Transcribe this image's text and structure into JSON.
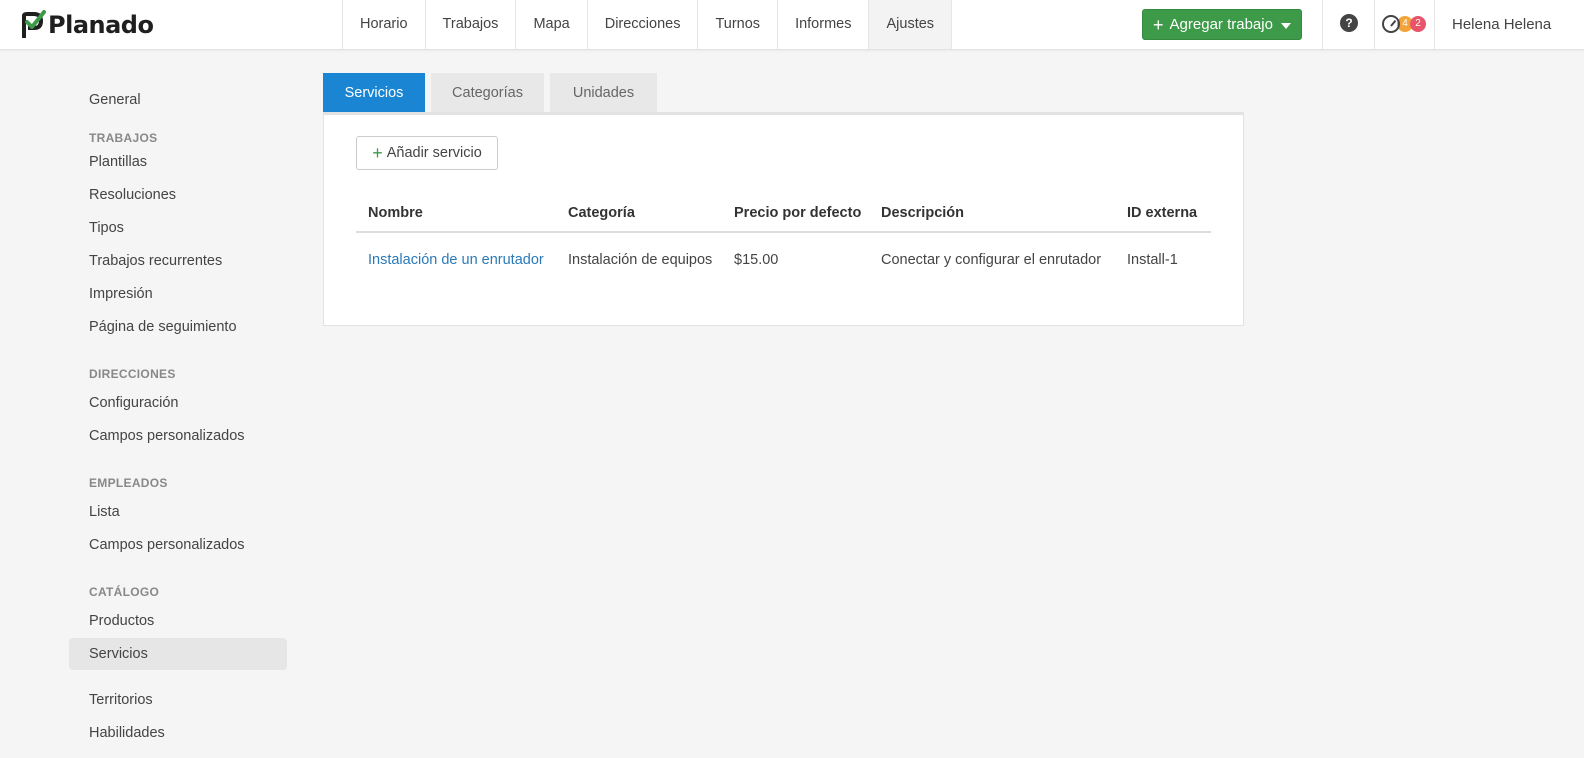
{
  "app": {
    "name": "Planado"
  },
  "colors": {
    "accent": "#1a85d3",
    "primary_button": "#3c9a48",
    "link": "#2a7ab8",
    "badge_orange": "#f2a43a",
    "badge_red": "#e8546a"
  },
  "nav": {
    "items": [
      {
        "label": "Horario"
      },
      {
        "label": "Trabajos"
      },
      {
        "label": "Mapa"
      },
      {
        "label": "Direcciones"
      },
      {
        "label": "Turnos"
      },
      {
        "label": "Informes"
      },
      {
        "label": "Ajustes"
      }
    ],
    "active": "Ajustes"
  },
  "header": {
    "add_job_label": "Agregar trabajo",
    "help_label": "?",
    "notif_orange": "4",
    "notif_red": "2",
    "user_name": "Helena Helena"
  },
  "sidebar": {
    "general": "General",
    "sections": [
      {
        "heading": "TRABAJOS",
        "items": [
          "Plantillas",
          "Resoluciones",
          "Tipos",
          "Trabajos recurrentes",
          "Impresión",
          "Página de seguimiento"
        ]
      },
      {
        "heading": "DIRECCIONES",
        "items": [
          "Configuración",
          "Campos personalizados"
        ]
      },
      {
        "heading": "EMPLEADOS",
        "items": [
          "Lista",
          "Campos personalizados"
        ]
      },
      {
        "heading": "CATÁLOGO",
        "items": [
          "Productos",
          "Servicios"
        ]
      }
    ],
    "extra": [
      "Territorios",
      "Habilidades"
    ],
    "active": "Servicios"
  },
  "tabs": [
    {
      "label": "Servicios"
    },
    {
      "label": "Categorías"
    },
    {
      "label": "Unidades"
    }
  ],
  "main": {
    "add_service_label": "Añadir servicio",
    "table": {
      "headers": [
        "Nombre",
        "Categoría",
        "Precio por defecto",
        "Descripción",
        "ID externa"
      ],
      "rows": [
        [
          "Instalación de un enrutador",
          "Instalación de equipos",
          "$15.00",
          "Conectar y configurar el enrutador",
          "Install-1"
        ]
      ]
    }
  }
}
